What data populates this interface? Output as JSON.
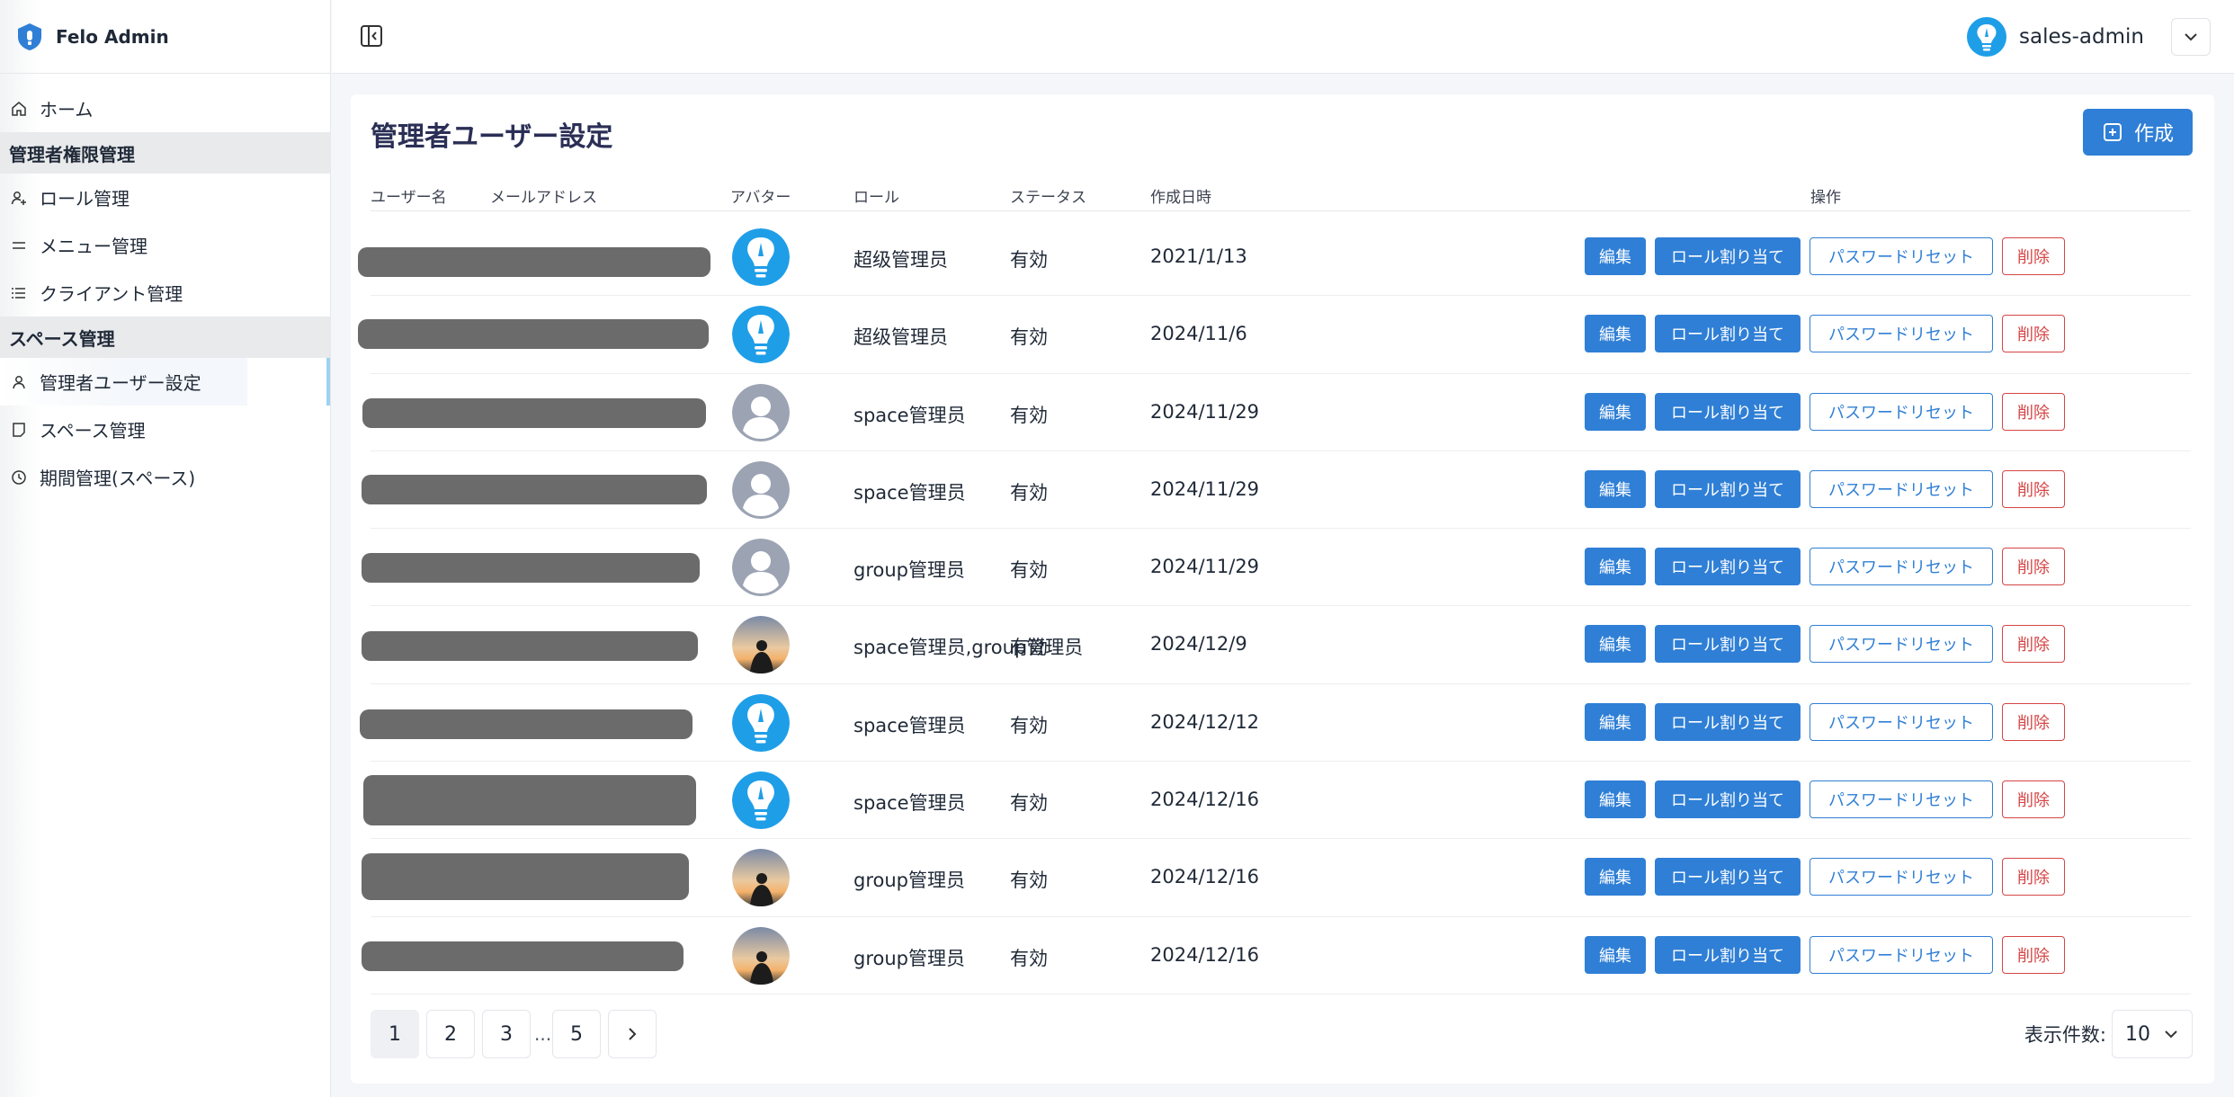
{
  "app": {
    "name": "Felo Admin"
  },
  "header": {
    "username": "sales-admin"
  },
  "sidebar": {
    "items": [
      {
        "label": "ホーム"
      },
      {
        "label": "管理者権限管理"
      },
      {
        "label": "ロール管理"
      },
      {
        "label": "メニュー管理"
      },
      {
        "label": "クライアント管理"
      },
      {
        "label": "スペース管理"
      },
      {
        "label": "管理者ユーザー設定"
      },
      {
        "label": "スペース管理"
      },
      {
        "label": "期間管理(スペース)"
      }
    ]
  },
  "page": {
    "title": "管理者ユーザー設定",
    "create_label": "作成"
  },
  "table": {
    "columns": [
      "ユーザー名",
      "メールアドレス",
      "アバター",
      "ロール",
      "ステータス",
      "作成日時",
      "操作"
    ],
    "action_labels": {
      "edit": "編集",
      "assign_role": "ロール割り当て",
      "reset_password": "パスワードリセット",
      "delete": "削除"
    },
    "rows": [
      {
        "avatar": "felo-logo-icon",
        "role": "超级管理员",
        "status": "有効",
        "created": "2021/1/13"
      },
      {
        "avatar": "felo-logo-icon",
        "role": "超级管理员",
        "status": "有効",
        "created": "2024/11/6"
      },
      {
        "avatar": "default-user-icon",
        "role": "space管理员",
        "status": "有効",
        "created": "2024/11/29"
      },
      {
        "avatar": "default-user-icon",
        "role": "space管理员",
        "status": "有効",
        "created": "2024/11/29"
      },
      {
        "avatar": "default-user-icon",
        "role": "group管理员",
        "status": "有効",
        "created": "2024/11/29"
      },
      {
        "avatar": "sunset-photo-icon",
        "role": "space管理员,group管理员",
        "status": "有効",
        "created": "2024/12/9"
      },
      {
        "avatar": "felo-logo-icon",
        "role": "space管理员",
        "status": "有効",
        "created": "2024/12/12"
      },
      {
        "avatar": "felo-logo-icon",
        "role": "space管理员",
        "status": "有効",
        "created": "2024/12/16"
      },
      {
        "avatar": "sunset-photo-icon",
        "role": "group管理员",
        "status": "有効",
        "created": "2024/12/16"
      },
      {
        "avatar": "sunset-photo-icon",
        "role": "group管理员",
        "status": "有効",
        "created": "2024/12/16"
      }
    ]
  },
  "pagination": {
    "pages": [
      "1",
      "2",
      "3",
      "5"
    ],
    "ellipsis": "...",
    "current": "1",
    "page_size_label": "表示件数:",
    "page_size": "10"
  },
  "colors": {
    "primary": "#2f7fd6",
    "danger": "#d64545",
    "title": "#2b2f56"
  }
}
